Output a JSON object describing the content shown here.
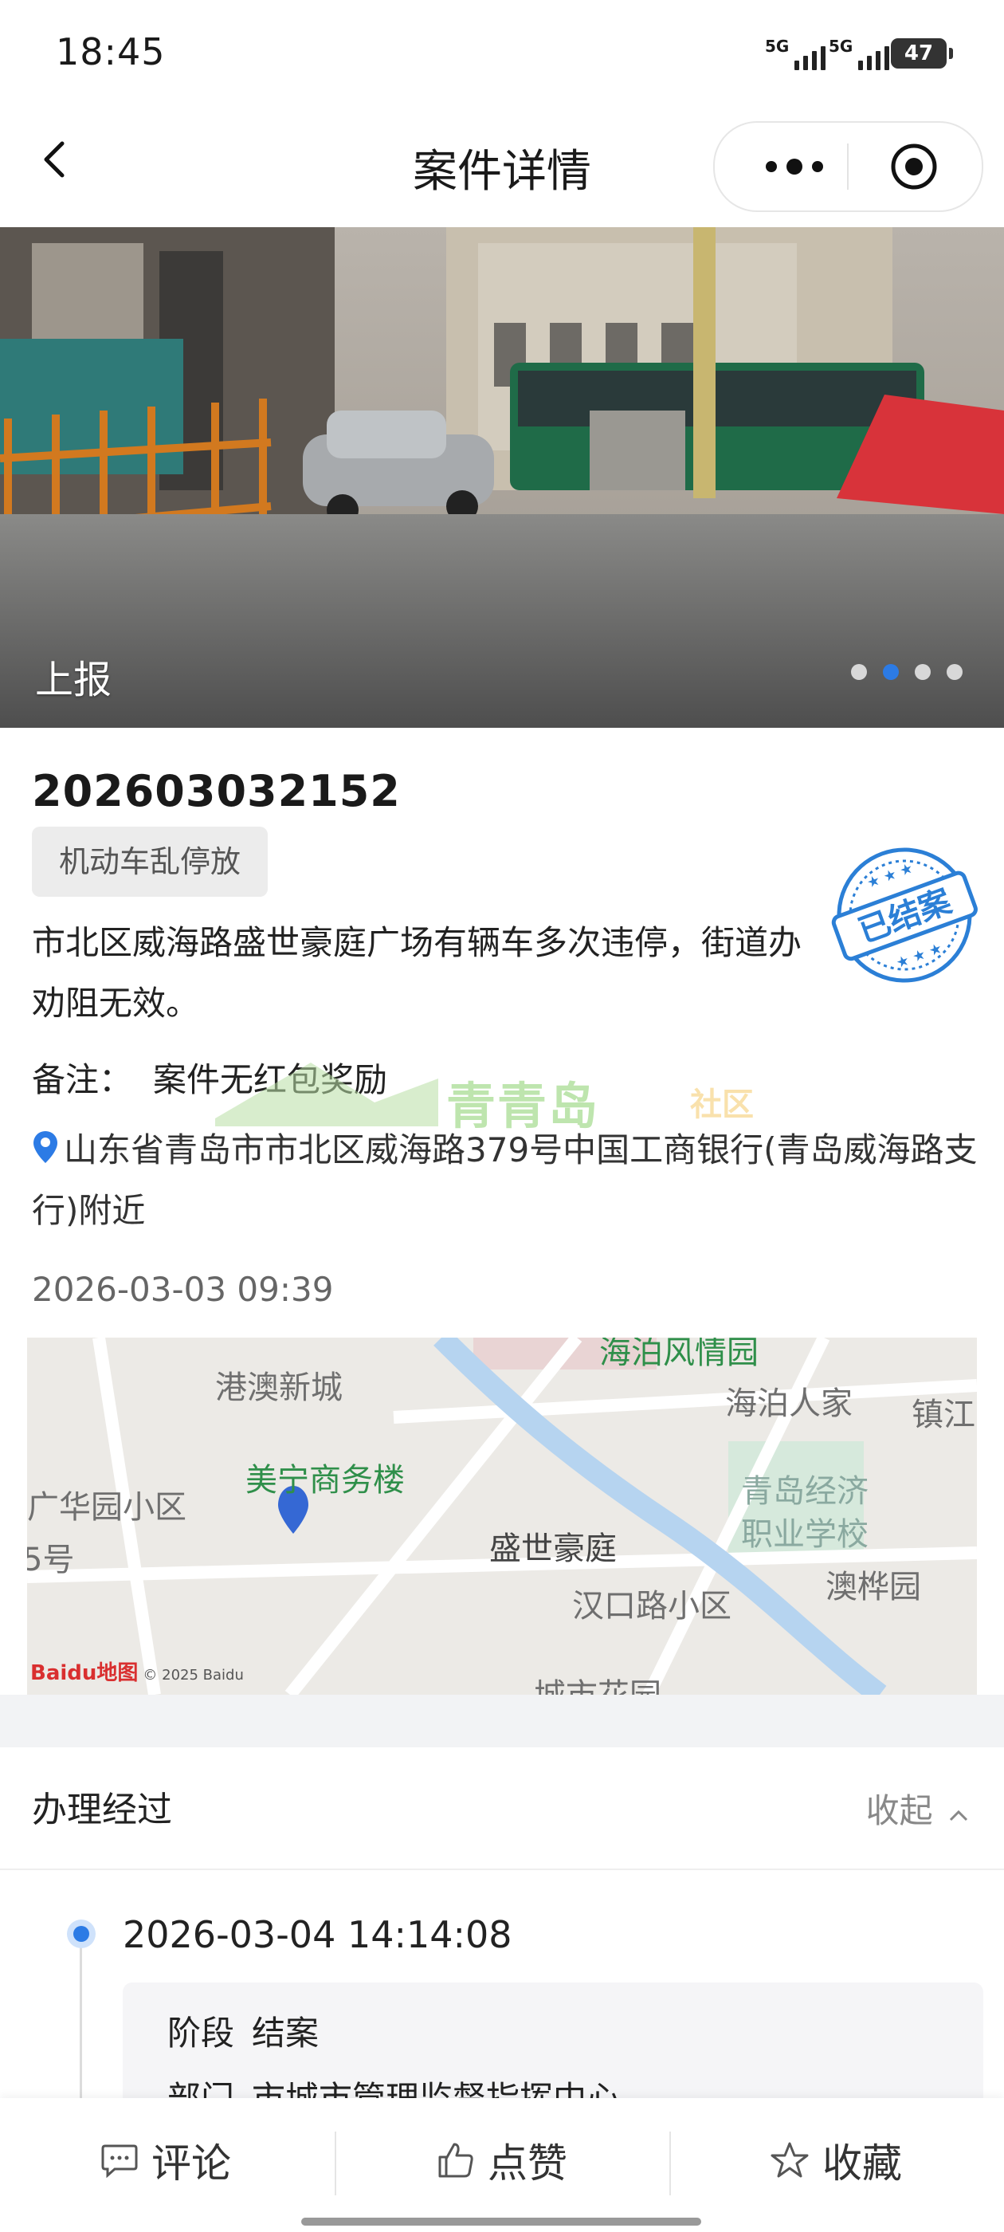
{
  "status_bar": {
    "time": "18:45",
    "signal1": "5G",
    "signal2": "5G",
    "battery": "47"
  },
  "nav": {
    "title": "案件详情"
  },
  "photo": {
    "caption": "上报",
    "pages": 4,
    "active_page": 2
  },
  "case": {
    "number": "202603032152",
    "category": "机动车乱停放",
    "description": "市北区威海路盛世豪庭广场有辆车多次违停，街道办劝阻无效。",
    "stamp": "已结案",
    "remark_label": "备注：",
    "remark_value": "案件无红包奖励",
    "address": "山东省青岛市市北区威海路379号中国工商银行(青岛威海路支行)附近",
    "time": "2026-03-03 09:39",
    "watermark_title": "青青岛",
    "watermark_sub": "社区"
  },
  "map": {
    "labels": {
      "l1": "港澳新城",
      "l2": "海泊风情园",
      "l3": "海泊人家",
      "l4": "镇江",
      "l5": "美宁商务楼",
      "l6": "广华园小区",
      "l7": "青岛经济",
      "l8": "职业学校",
      "l9": "盛世豪庭",
      "l10": "5号",
      "l11": "澳桦园",
      "l12": "汉口路小区",
      "l13": "城市花园"
    },
    "logo": "Baidu地图",
    "copyright": "© 2025 Baidu"
  },
  "process": {
    "title": "办理经过",
    "toggle": "收起",
    "entries": [
      {
        "time": "2026-03-04 14:14:08",
        "stage_label": "阶段",
        "stage": "结案",
        "dept_label": "部门",
        "dept": "市城市管理监督指挥中心"
      }
    ]
  },
  "bottom_bar": {
    "comment": "评论",
    "like": "点赞",
    "favorite": "收藏"
  },
  "colors": {
    "accent": "#2c7be5",
    "tag_bg": "#ececec",
    "stamp": "#2b7fd6"
  }
}
